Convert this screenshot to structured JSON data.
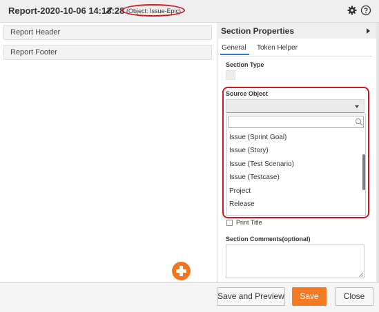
{
  "header": {
    "title": "Report-2020-10-06 14:13:28",
    "object_badge": "(Object: Issue-Epic)",
    "icons": [
      "pencil-icon",
      "gear-icon",
      "help-icon"
    ]
  },
  "sections": [
    "Report Header",
    "Report Footer"
  ],
  "panel": {
    "title": "Section Properties",
    "tabs": [
      "General",
      "Token Helper"
    ],
    "active_tab": "General",
    "section_type_label": "Section Type",
    "source_object": {
      "label": "Source Object",
      "value": "",
      "search_placeholder": "",
      "options": [
        "Issue (Sprint Goal)",
        "Issue (Story)",
        "Issue (Test Scenario)",
        "Issue (Testcase)",
        "Project",
        "Release"
      ]
    },
    "print_title_label": "Print Title",
    "comments_label": "Section Comments(optional)",
    "comments_value": ""
  },
  "footer": {
    "preview_label": "Save and Preview",
    "save_label": "Save",
    "close_label": "Close"
  },
  "colors": {
    "accent": "#f47b23",
    "highlight": "#d01820",
    "tab_underline": "#2b7bd0"
  }
}
